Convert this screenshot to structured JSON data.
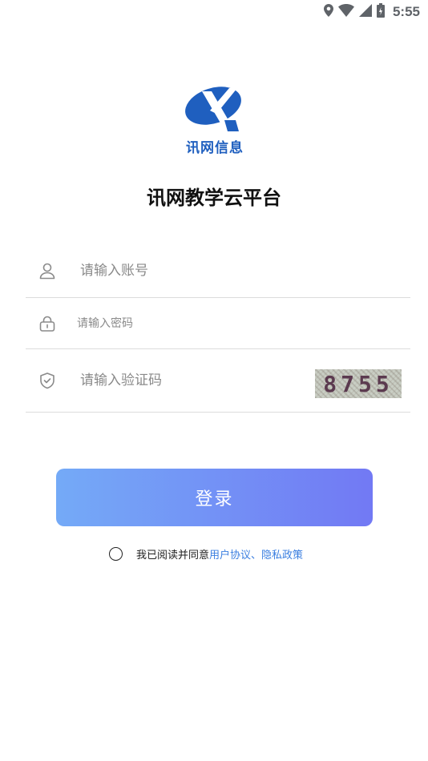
{
  "status_bar": {
    "time": "5:55",
    "icons": [
      "location-icon",
      "wifi-icon",
      "signal-icon",
      "battery-icon"
    ]
  },
  "brand": {
    "logo_text": "讯网信息",
    "logo_color": "#1f5fbf"
  },
  "app_title": "讯网教学云平台",
  "form": {
    "account": {
      "placeholder": "请输入账号",
      "value": "",
      "icon": "user-icon"
    },
    "password": {
      "placeholder": "请输入密码",
      "value": "",
      "icon": "lock-icon"
    },
    "captcha": {
      "placeholder": "请输入验证码",
      "value": "",
      "icon": "shield-check-icon",
      "captcha_code": "8755"
    }
  },
  "login_button": {
    "label": "登录",
    "gradient_start": "#74aaf7",
    "gradient_end": "#7279f4"
  },
  "agreement": {
    "checked": false,
    "prefix": "我已阅读并同意",
    "links": "用户协议、隐私政策",
    "link_color": "#3b7fe0"
  }
}
